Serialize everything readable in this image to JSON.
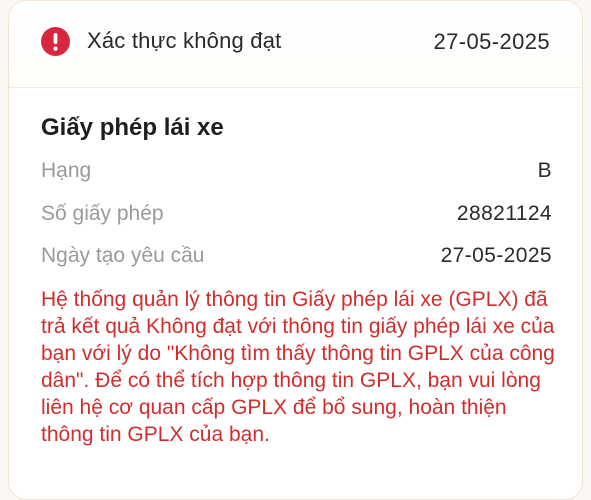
{
  "status": {
    "icon": "exclamation-circle-icon",
    "text": "Xác thực không đạt",
    "date": "27-05-2025",
    "color": "#d7263d"
  },
  "section": {
    "title": "Giấy phép lái xe"
  },
  "rows": [
    {
      "label": "Hạng",
      "value": "B"
    },
    {
      "label": "Số giấy phép",
      "value": "28821124"
    },
    {
      "label": "Ngày tạo yêu cầu",
      "value": "27-05-2025"
    }
  ],
  "message": "Hệ thống quản lý thông tin Giấy phép lái xe (GPLX) đã trả kết quả Không đạt với thông tin giấy phép lái xe của bạn với lý do \"Không tìm thấy thông tin GPLX của công dân\". Để có thể tích hợp thông tin GPLX, bạn vui lòng liên hệ cơ quan cấp GPLX để bổ sung, hoàn thiện thông tin GPLX của bạn.",
  "message_color": "#d22d2d"
}
